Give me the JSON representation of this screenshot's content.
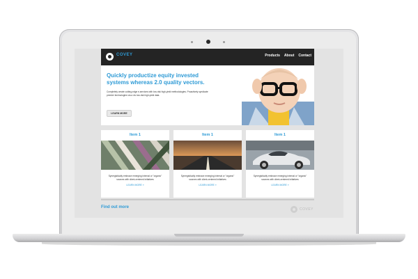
{
  "site": {
    "brand": "COVEY",
    "nav": [
      "Products",
      "About",
      "Contact"
    ]
  },
  "hero": {
    "title": "Quickly productize equity invested systems whereas 2.0 quality vectors.",
    "text": "Completely create cutting-edge e-services with low-risk high-yield methodologies. Proactively syndicate premier technologies via a vis low-risk high-yield data.",
    "button": "LEARN MORE"
  },
  "items": [
    {
      "title": "Item 1",
      "text": "Synergistically embrace emerging internal or \"organic\" sources with client-centered initiatives",
      "link": "LEARN MORE »"
    },
    {
      "title": "Item 1",
      "text": "Synergistically embrace emerging internal or \"organic\" sources with client-centered initiatives",
      "link": "LEARN MORE »"
    },
    {
      "title": "Item 1",
      "text": "Synergistically embrace emerging internal or \"organic\" sources with client-centered initiatives",
      "link": "LEARN MORE »"
    }
  ],
  "footer": {
    "find_more": "Find out more",
    "brand": "COVEY"
  },
  "colors": {
    "accent": "#2f9bd6",
    "header": "#242424"
  }
}
